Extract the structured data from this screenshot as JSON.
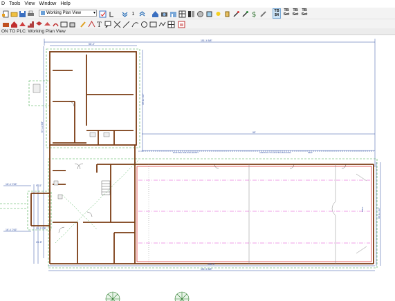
{
  "menu": {
    "items": [
      "D",
      "Tools",
      "View",
      "Window",
      "Help"
    ]
  },
  "toolbar": {
    "view_select_value": "Working Plan View",
    "icons_row1": [
      "new-plan-icon",
      "open-icon",
      "save-icon",
      "print-icon",
      "undo-icon",
      "layer-icon",
      "help-icon",
      "select-arrow-icon",
      "down-icon",
      "up-icon",
      "house-icon",
      "camera-icon",
      "elevation-icon",
      "plan-icon",
      "material-icon",
      "door-icon",
      "window-icon",
      "light-icon",
      "bulb-icon",
      "eyedropper-icon",
      "paint-icon",
      "dollar-icon",
      "brush-icon"
    ],
    "tb_sets": [
      {
        "line1": "TB",
        "line2": "$4",
        "active": true
      },
      {
        "line1": "TB",
        "line2": "Set",
        "active": false
      },
      {
        "line1": "TB",
        "line2": "Set",
        "active": false
      },
      {
        "line1": "TB",
        "line2": "Set",
        "active": false
      }
    ],
    "icons_row2": [
      "draw-wall-icon",
      "home-icon",
      "roof-icon",
      "stair-icon",
      "cabinet-icon",
      "fixture-icon",
      "rect-icon",
      "pencil-icon",
      "dimension-icon",
      "text-icon",
      "callout-icon",
      "line-icon",
      "arc-icon",
      "circle-icon",
      "box-icon",
      "spline-icon",
      "grid-icon",
      "pdf-icon"
    ],
    "selector_number": "1"
  },
  "breadcrumb": {
    "text": "ON TO PLC: Working Plan View"
  },
  "plan": {
    "dimensions": {
      "top_overall": "151'-4 5/8\"",
      "top_wing": "56'-4\"",
      "wing_height": "49'-11 1/2\"",
      "left_height": "57'-11 5/8\"",
      "mid_span": "95'",
      "bottom_overall": "151'-4 5/8\"",
      "bottom_inner": "135'-3\"",
      "right_height": "40'-11 1/2\"",
      "left_a": "16'-4 7/16\"",
      "left_b": "9'-11\"",
      "left_c": "16'-4 7/16\"",
      "left_d": "21'-2 7/8\"",
      "left_e": "23'-8\""
    },
    "labels": {
      "room_label_a": "EXISTING BUILDING ENTRY",
      "room_label_b": "ADDITION TO EXISTING BUILDING",
      "room_label_c": "NEW",
      "right_label": "WALL"
    },
    "colors": {
      "wall": "#7a3b12",
      "dimension": "#2b4aa0",
      "magenta": "#e040d0",
      "green": "#3aa845",
      "red": "#d42020"
    }
  }
}
